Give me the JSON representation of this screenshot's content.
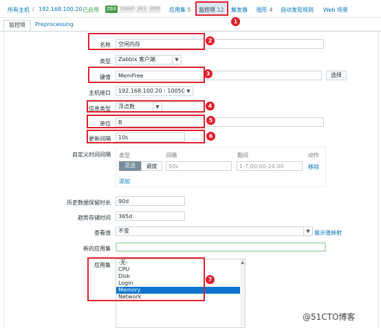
{
  "topnav": {
    "all_hosts": "所有主机",
    "sep": "/",
    "host_ip": "192.168.100.20",
    "status": "已启用",
    "badges": [
      "ZBX",
      "SNMP",
      "JMX",
      "IPMI"
    ],
    "tabs": [
      {
        "label": "应用集",
        "count": "5"
      },
      {
        "label": "监控项",
        "count": "12"
      },
      {
        "label": "触发器",
        "count": ""
      },
      {
        "label": "图形",
        "count": "4"
      },
      {
        "label": "自动发现规则",
        "count": ""
      },
      {
        "label": "Web 场景",
        "count": ""
      }
    ]
  },
  "subtabs": [
    "监控项",
    "Preprocessing"
  ],
  "form": {
    "name_label": "名称",
    "name_value": "空闲内存",
    "type_label": "类型",
    "type_value": "Zabbix 客户端",
    "key_label": "键值",
    "key_value": "MemFree",
    "select_button": "选择",
    "interface_label": "主机接口",
    "interface_value": "192.168.100.20 : 10050",
    "info_type_label": "信息类型",
    "info_type_value": "浮点数",
    "units_label": "单位",
    "units_value": "B",
    "interval_label": "更新间隔",
    "interval_value": "10s",
    "custom_label": "自定义时间间隔",
    "custom_headers": [
      "类型",
      "间隔",
      "期间",
      "动作"
    ],
    "custom_seg": [
      "灵活",
      "调度"
    ],
    "custom_interval_placeholder": "50s",
    "custom_period_placeholder": "1-7,00:00-24:00",
    "custom_remove": "移除",
    "custom_add": "添加",
    "history_label": "历史数据保留时长",
    "history_value": "90d",
    "trends_label": "趋势存储时间",
    "trends_value": "365d",
    "showvalue_label": "查看值",
    "showvalue_value": "不变",
    "showvalue_link": "展示值映射",
    "newapp_label": "新的应用集",
    "newapp_value": "",
    "apps_label": "应用集",
    "apps": [
      "-无-",
      "CPU",
      "Disk",
      "Login",
      "Memory",
      "Network"
    ],
    "apps_selected": "Memory"
  },
  "annotations": [
    "1",
    "2",
    "3",
    "4",
    "5",
    "6",
    "7"
  ],
  "watermark": "@51CTO博客",
  "colors": {
    "link": "#0275b8",
    "annotation_red": "#e11d2b",
    "enabled_green": "#429e47",
    "selected_blue": "#0b74cf"
  }
}
